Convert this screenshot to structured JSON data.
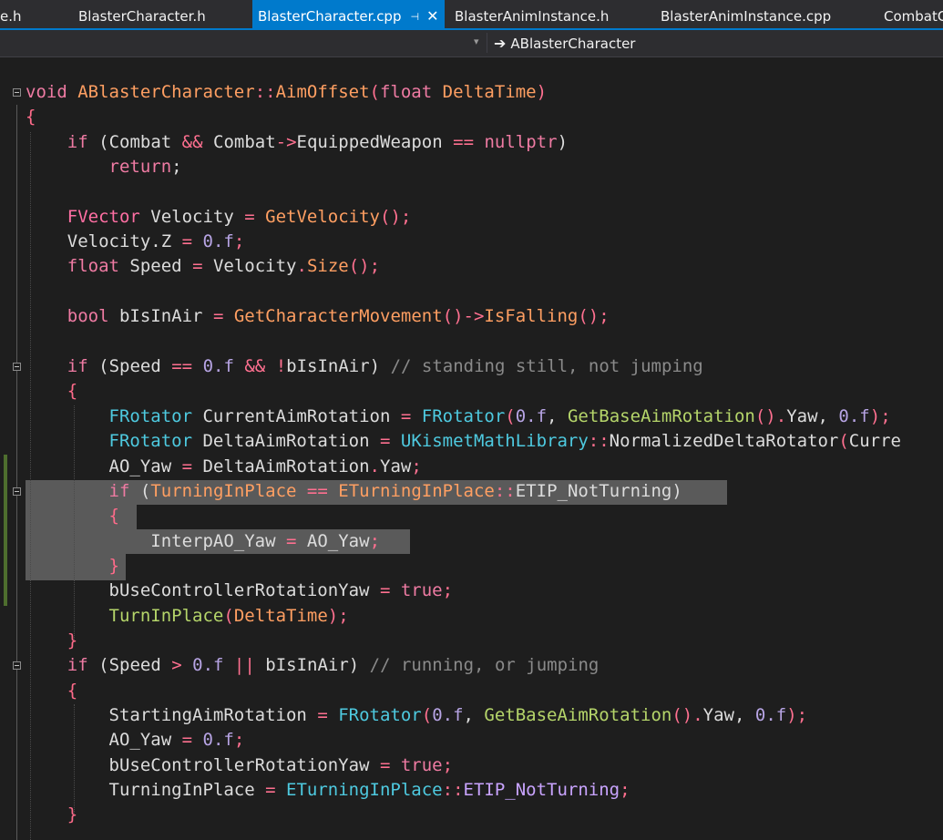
{
  "tabs": [
    {
      "label": "e.h"
    },
    {
      "label": "BlasterCharacter.h"
    },
    {
      "label": "BlasterCharacter.cpp",
      "pin": "⊣",
      "close": "✕"
    },
    {
      "label": "BlasterAnimInstance.h"
    },
    {
      "label": "BlasterAnimInstance.cpp"
    },
    {
      "label": "CombatC"
    }
  ],
  "nav": {
    "member": "ABlasterCharacter"
  },
  "code": {
    "l1": [
      "void",
      "ABlasterCharacter",
      "::",
      "AimOffset",
      "(",
      "float",
      "DeltaTime",
      ")"
    ],
    "l2": "{",
    "l3": [
      "if",
      "(",
      "Combat",
      "&&",
      "Combat",
      "->",
      "EquippedWeapon",
      "==",
      "nullptr",
      ")"
    ],
    "l4": [
      "return",
      ";"
    ],
    "l6": [
      "FVector",
      "Velocity",
      "=",
      "GetVelocity",
      "();"
    ],
    "l7": [
      "Velocity",
      ".",
      "Z",
      "=",
      "0.f",
      ";"
    ],
    "l8": [
      "float",
      "Speed",
      "=",
      "Velocity",
      ".",
      "Size",
      "();"
    ],
    "l10": [
      "bool",
      "bIsInAir",
      "=",
      "GetCharacterMovement",
      "()->",
      "IsFalling",
      "();"
    ],
    "l12": [
      "if",
      "(",
      "Speed",
      "==",
      "0.f",
      "&&",
      "!",
      "bIsInAir",
      ")",
      "// standing still, not jumping"
    ],
    "l13": "{",
    "l14": [
      "FRotator",
      "CurrentAimRotation",
      "=",
      "FRotator",
      "(",
      "0.f",
      ",",
      "GetBaseAimRotation",
      "().",
      "Yaw",
      ",",
      "0.f",
      ");"
    ],
    "l15": [
      "FRotator",
      "DeltaAimRotation",
      "=",
      "UKismetMathLibrary",
      "::",
      "NormalizedDeltaRotator",
      "(",
      "Curre"
    ],
    "l16": [
      "AO_Yaw",
      "=",
      "DeltaAimRotation",
      ".",
      "Yaw",
      ";"
    ],
    "l17": [
      "if",
      "(",
      "TurningInPlace",
      "==",
      "ETurningInPlace",
      "::",
      "ETIP_NotTurning",
      ")"
    ],
    "l18": "{",
    "l19": [
      "InterpAO_Yaw",
      "=",
      "AO_Yaw",
      ";"
    ],
    "l20": "}",
    "l21": [
      "bUseControllerRotationYaw",
      "=",
      "true",
      ";"
    ],
    "l22": [
      "TurnInPlace",
      "(",
      "DeltaTime",
      ");"
    ],
    "l23": "}",
    "l24": [
      "if",
      "(",
      "Speed",
      ">",
      "0.f",
      "||",
      "bIsInAir",
      ")",
      "// running, or jumping"
    ],
    "l25": "{",
    "l26": [
      "StartingAimRotation",
      "=",
      "FRotator",
      "(",
      "0.f",
      ",",
      "GetBaseAimRotation",
      "().",
      "Yaw",
      ",",
      "0.f",
      ");"
    ],
    "l27": [
      "AO_Yaw",
      "=",
      "0.f",
      ";"
    ],
    "l28": [
      "bUseControllerRotationYaw",
      "=",
      "true",
      ";"
    ],
    "l29": [
      "TurningInPlace",
      "=",
      "ETurningInPlace",
      "::",
      "ETIP_NotTurning",
      ";"
    ],
    "l30": "}"
  }
}
